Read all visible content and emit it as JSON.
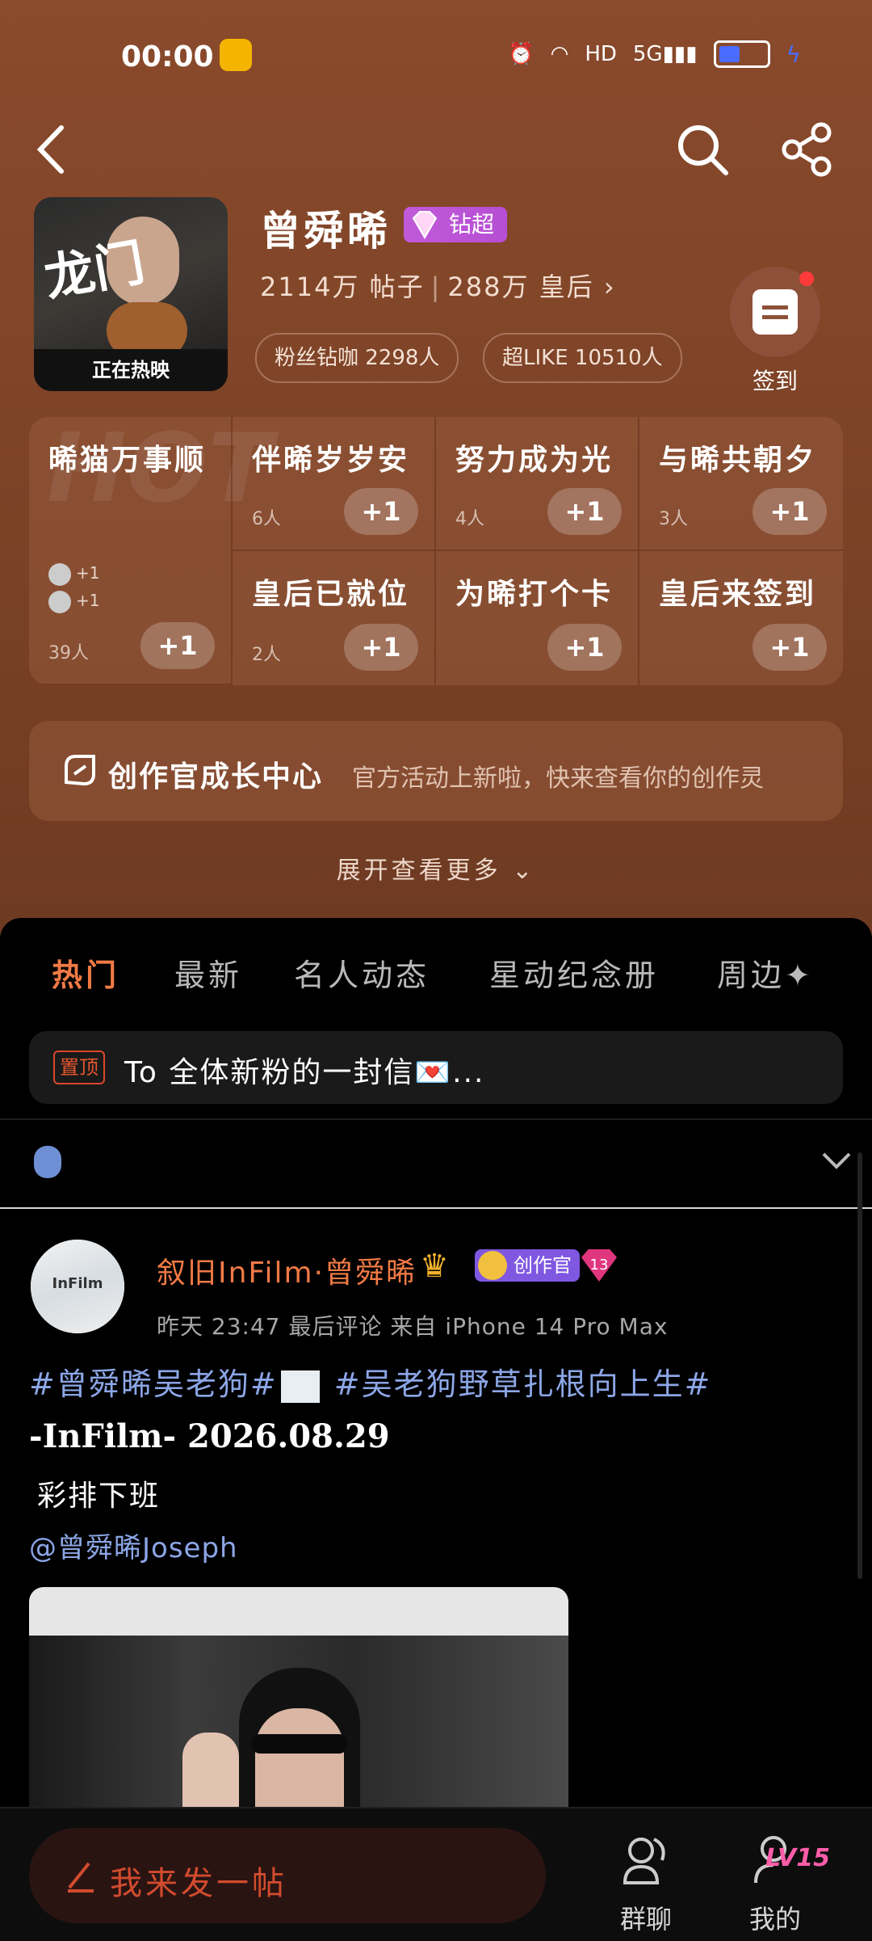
{
  "status_bar": {
    "time": "00:00",
    "battery_percent": 45
  },
  "header": {
    "poster_title": "龙门",
    "poster_banner": "正在热映",
    "name": "曾舜晞",
    "super_badge": "钻超",
    "posts_count": "2114万 帖子",
    "fans_group": "288万 皇后",
    "fans_chip": "粉丝钻咖 2298人",
    "like_chip": "超LIKE 10510人",
    "signin_label": "签到"
  },
  "checkin_topics": {
    "watermark": "HOT",
    "items": [
      {
        "title": "晞猫万事顺",
        "count": "39人",
        "plus": "+1",
        "avatar_1": "+1",
        "avatar_2": "+1"
      },
      {
        "title": "伴晞岁岁安",
        "count": "6人",
        "plus": "+1"
      },
      {
        "title": "努力成为光",
        "count": "4人",
        "plus": "+1"
      },
      {
        "title": "与晞共朝夕",
        "count": "3人",
        "plus": "+1"
      },
      {
        "title": "皇后已就位",
        "count": "2人",
        "plus": "+1"
      },
      {
        "title": "为晞打个卡",
        "count": "",
        "plus": "+1"
      },
      {
        "title": "皇后来签到",
        "count": "",
        "plus": "+1"
      }
    ]
  },
  "creator_center": {
    "title": "创作官成长中心",
    "subtitle": "官方活动上新啦，快来查看你的创作灵"
  },
  "expand_more": "展开查看更多",
  "tabs": [
    "热门",
    "最新",
    "名人动态",
    "星动纪念册",
    "周边✦"
  ],
  "pinned": {
    "tag": "置顶",
    "text": "To 全体新粉的一封信💌..."
  },
  "post": {
    "avatar_label": "InFilm",
    "user": "叙旧InFilm·曾舜晞",
    "creator_badge": "创作官",
    "level_badge": "13",
    "meta": "昨天 23:47 最后评论   来自 iPhone 14 Pro Max",
    "hashtag_1": "#曾舜晞吴老狗#",
    "hashtag_2": "#吴老狗野草扎根向上生#",
    "line1": "-InFilm- 2026.08.29",
    "line2": "彩排下班",
    "mention": "@曾舜晞Joseph"
  },
  "bottom_bar": {
    "compose": "我来发一帖",
    "group_chat": "群聊",
    "mine": "我的",
    "level": "LV15"
  }
}
